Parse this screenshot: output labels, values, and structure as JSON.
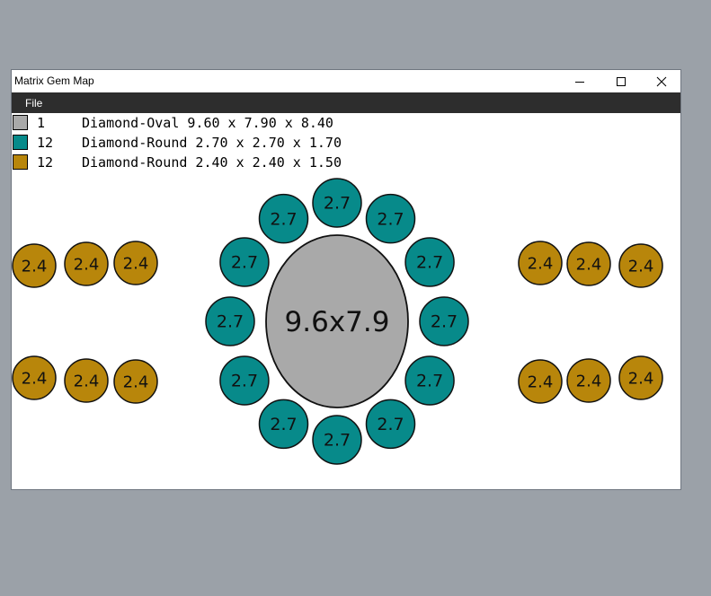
{
  "window": {
    "title": "Matrix Gem Map",
    "minimize_icon": "minimize-icon",
    "maximize_icon": "maximize-icon",
    "close_icon": "close-icon"
  },
  "menu": {
    "file_label": "File"
  },
  "colors": {
    "oval": "#a9a9a9",
    "round_teal": "#078a8a",
    "round_gold": "#b8860b"
  },
  "legend": [
    {
      "count": "1",
      "description": "Diamond-Oval 9.60 x 7.90 x 8.40",
      "color": "#a9a9a9"
    },
    {
      "count": "12",
      "description": "Diamond-Round 2.70 x 2.70 x 1.70",
      "color": "#078a8a"
    },
    {
      "count": "12",
      "description": "Diamond-Round 2.40 x 2.40 x 1.50",
      "color": "#b8860b"
    }
  ],
  "map": {
    "center": {
      "label": "9.6x7.9",
      "color": "#a9a9a9"
    },
    "halo_label": "2.7",
    "halo_count": 12,
    "side_label": "2.4"
  }
}
